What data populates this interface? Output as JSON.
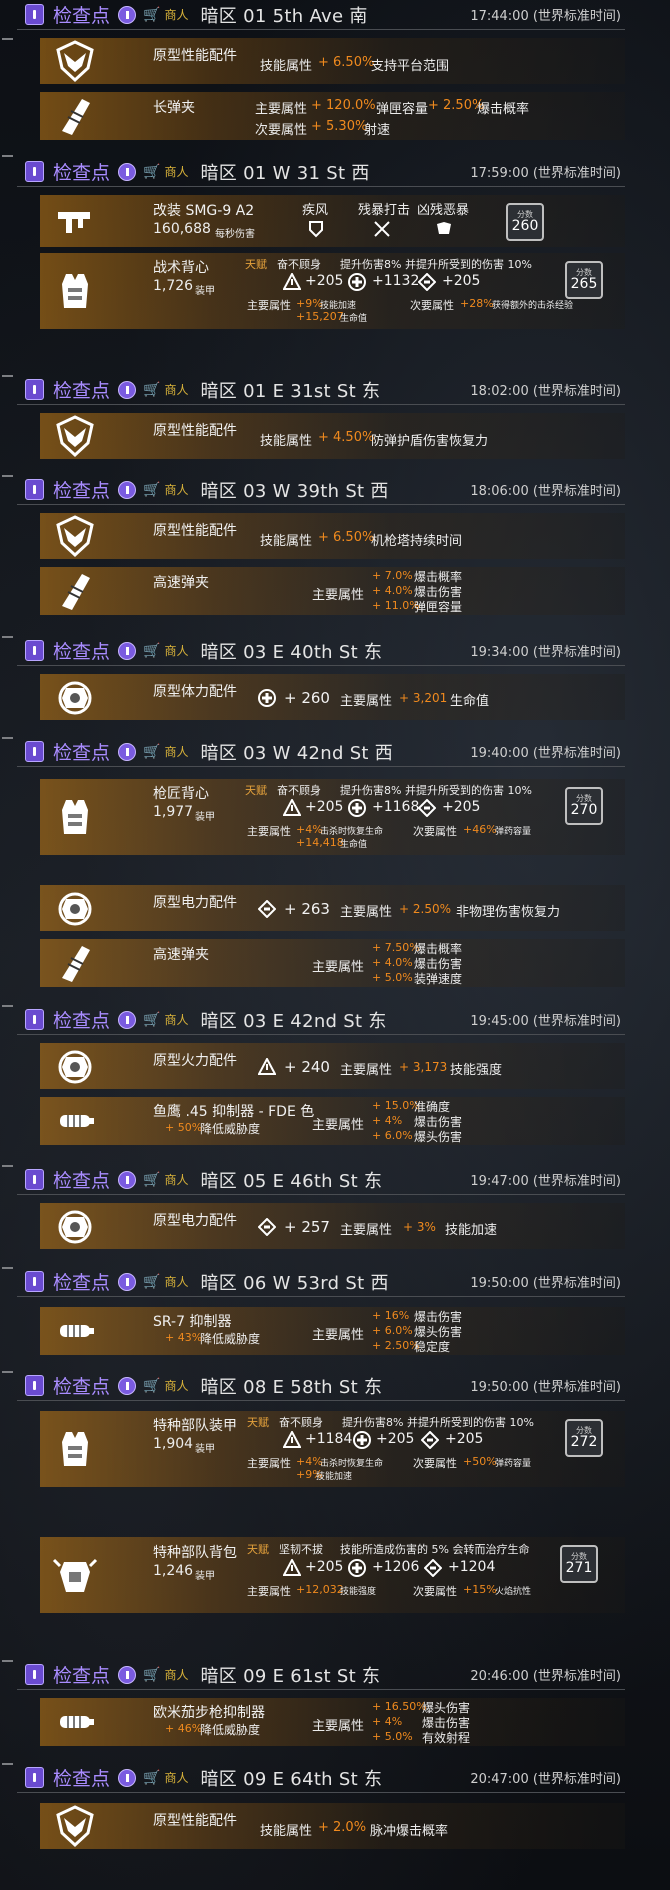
{
  "common": {
    "checkpoint_label": "检查点",
    "vendor_label": "商人",
    "core_attr": "主要属性",
    "minor_attr": "次要属性",
    "skill_attr": "技能属性",
    "armor_unit": "装甲",
    "dps_unit": "每秒伤害",
    "score_label": "分数",
    "exotic_tag": "天赋"
  },
  "cp1": {
    "location": "暗区 01 5th Ave 南",
    "time": "17:44:00 (世界标准时间)"
  },
  "cp1_item1": {
    "name": "原型性能配件",
    "attr_label": "技能属性",
    "value": "+ 6.50%",
    "desc": "支持平台范围"
  },
  "cp1_item2": {
    "name": "长弹夹",
    "main_label": "主要属性",
    "main1": "+ 120.0%",
    "main1_desc": "弹匣容量",
    "main2": "+ 2.50%",
    "main2_desc": "爆击概率",
    "minor_label": "次要属性",
    "minor1": "+ 5.30%",
    "minor1_desc": "射速"
  },
  "cp2": {
    "location": "暗区 01 W 31 St 西",
    "time": "17:59:00 (世界标准时间)"
  },
  "cp2_item1": {
    "name": "改装 SMG-9 A2",
    "dps": "160,688",
    "dps_unit": "每秒伤害",
    "talent1": "疾风",
    "talent2": "残暴打击",
    "talent3": "凶残恶暴",
    "score": "260"
  },
  "cp2_item2": {
    "name": "战术背心",
    "armor": "1,726",
    "armor_unit": "装甲",
    "tag": "天赋",
    "talent_name": "奋不顾身",
    "talent_desc": "提升伤害8% 并提升所受到的伤害 10%",
    "stat1": "+205",
    "stat2": "+1132",
    "stat3": "+205",
    "main_label": "主要属性",
    "main1": "+9%",
    "main1_desc": "技能加速",
    "main2": "+15,207",
    "main2_desc": "生命值",
    "minor_label": "次要属性",
    "minor1": "+28%",
    "minor1_desc": "获得额外的击杀经验",
    "score": "265"
  },
  "cp3": {
    "location": "暗区 01 E 31st St 东",
    "time": "18:02:00 (世界标准时间)"
  },
  "cp3_item1": {
    "name": "原型性能配件",
    "attr_label": "技能属性",
    "value": "+ 4.50%",
    "desc": "防弹护盾伤害恢复力"
  },
  "cp4": {
    "location": "暗区 03 W 39th St 西",
    "time": "18:06:00 (世界标准时间)"
  },
  "cp4_item1": {
    "name": "原型性能配件",
    "attr_label": "技能属性",
    "value": "+ 6.50%",
    "desc": "机枪塔持续时间"
  },
  "cp4_item2": {
    "name": "高速弹夹",
    "main_label": "主要属性",
    "v1": "+ 7.0%",
    "d1": "爆击概率",
    "v2": "+ 4.0%",
    "d2": "爆击伤害",
    "v3": "+ 11.0%",
    "d3": "弹匣容量"
  },
  "cp5": {
    "location": "暗区 03 E 40th St   东",
    "time": "19:34:00 (世界标准时间)"
  },
  "cp5_item1": {
    "name": "原型体力配件",
    "stat": "+ 260",
    "main_label": "主要属性",
    "value": "+ 3,201",
    "desc": "生命值"
  },
  "cp6": {
    "location": "暗区 03 W 42nd St 西",
    "time": "19:40:00 (世界标准时间)"
  },
  "cp6_item1": {
    "name": "枪匠背心",
    "armor": "1,977",
    "armor_unit": "装甲",
    "tag": "天赋",
    "talent_name": "奋不顾身",
    "talent_desc": "提升伤害8% 并提升所受到的伤害 10%",
    "stat1": "+205",
    "stat2": "+1168",
    "stat3": "+205",
    "main_label": "主要属性",
    "main1": "+4%",
    "main1_desc": "击杀时恢复生命",
    "main2": "+14,418",
    "main2_desc": "生命值",
    "minor_label": "次要属性",
    "minor1": "+46%",
    "minor1_desc": "弹药容量",
    "score": "270"
  },
  "cp6_item2": {
    "name": "原型电力配件",
    "stat": "+ 263",
    "main_label": "主要属性",
    "value": "+ 2.50%",
    "desc": "非物理伤害恢复力"
  },
  "cp6_item3": {
    "name": "高速弹夹",
    "main_label": "主要属性",
    "v1": "+ 7.50%",
    "d1": "爆击概率",
    "v2": "+ 4.0%",
    "d2": "爆击伤害",
    "v3": "+ 5.0%",
    "d3": "装弹速度"
  },
  "cp7": {
    "location": "暗区 03 E 42nd St   东",
    "time": "19:45:00 (世界标准时间)"
  },
  "cp7_item1": {
    "name": "原型火力配件",
    "stat": "+ 240",
    "main_label": "主要属性",
    "value": "+ 3,173",
    "desc": "技能强度"
  },
  "cp7_item2": {
    "name": "鱼鹰 .45 抑制器 - FDE 色",
    "sub_value": "+ 50%",
    "sub_desc": "降低威胁度",
    "main_label": "主要属性",
    "v1": "+ 15.0%",
    "d1": "准确度",
    "v2": "+ 4%",
    "d2": "爆击伤害",
    "v3": "+ 6.0%",
    "d3": "爆头伤害"
  },
  "cp8": {
    "location": "暗区 05 E 46th St    东",
    "time": "19:47:00 (世界标准时间)"
  },
  "cp8_item1": {
    "name": "原型电力配件",
    "stat": "+ 257",
    "main_label": "主要属性",
    "value": "+ 3%",
    "desc": "技能加速"
  },
  "cp9": {
    "location": "暗区 06 W 53rd St  西",
    "time": "19:50:00 (世界标准时间)"
  },
  "cp9_item1": {
    "name": "SR-7 抑制器",
    "sub_value": "+ 43%",
    "sub_desc": "降低威胁度",
    "main_label": "主要属性",
    "v1": "+ 16%",
    "d1": "爆击伤害",
    "v2": "+ 6.0%",
    "d2": "爆头伤害",
    "v3": "+ 2.50%",
    "d3": "稳定度"
  },
  "cp10": {
    "location": "暗区 08 E 58th St    东",
    "time": "19:50:00 (世界标准时间)"
  },
  "cp10_item1": {
    "name": "特种部队装甲",
    "armor": "1,904",
    "armor_unit": "装甲",
    "tag": "天赋",
    "talent_name": "奋不顾身",
    "talent_desc": "提升伤害8% 并提升所受到的伤害 10%",
    "stat1": "+1184",
    "stat2": "+205",
    "stat3": "+205",
    "main_label": "主要属性",
    "main1": "+4%",
    "main1_desc": "击杀时恢复生命",
    "main2": "+9%",
    "main2_desc": "技能加速",
    "minor_label": "次要属性",
    "minor1": "+50%",
    "minor1_desc": "弹药容量",
    "score": "272"
  },
  "cp10_item2": {
    "name": "特种部队背包",
    "armor": "1,246",
    "armor_unit": "装甲",
    "tag": "天赋",
    "talent_name": "坚韧不拔",
    "talent_desc": "技能所造成伤害的 5% 会转而治疗生命",
    "stat1": "+205",
    "stat2": "+1206",
    "stat3": "+1204",
    "main_label": "主要属性",
    "main1": "+12,032",
    "main1_desc": "技能强度",
    "minor_label": "次要属性",
    "minor1": "+15%",
    "minor1_desc": "火焰抗性",
    "score": "271"
  },
  "cp11": {
    "location": "暗区 09 E 61st St    东",
    "time": "20:46:00 (世界标准时间)"
  },
  "cp11_item1": {
    "name": "欧米茄步枪抑制器",
    "sub_value": "+ 46%",
    "sub_desc": "降低威胁度",
    "main_label": "主要属性",
    "v1": "+ 16.50%",
    "d1": "爆头伤害",
    "v2": "+ 4%",
    "d2": "爆击伤害",
    "v3": "+ 5.0%",
    "d3": "有效射程"
  },
  "cp12": {
    "location": "暗区 09 E 64th St    东",
    "time": "20:47:00 (世界标准时间)"
  },
  "cp12_item1": {
    "name": "原型性能配件",
    "attr_label": "技能属性",
    "value": "+ 2.0%",
    "desc": "脉冲爆击概率"
  },
  "colors": {
    "accent_orange": "#f08a1e",
    "checkpoint_purple": "#a98cff",
    "vendor_gold": "#d8b23a"
  }
}
